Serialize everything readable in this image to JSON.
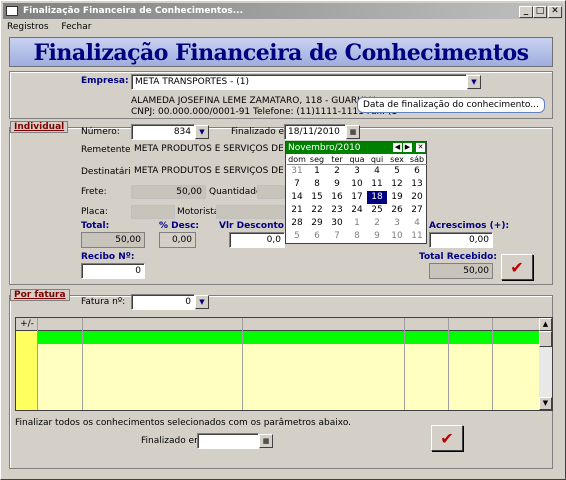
{
  "window": {
    "title": "Finalização Financeira de Conhecimentos..."
  },
  "menu": {
    "items": [
      "Registros",
      "Fechar"
    ]
  },
  "header": {
    "title": "Finalização Financeira de Conhecimentos"
  },
  "empresa": {
    "label": "Empresa:",
    "value": "META TRANSPORTES - (1)",
    "address": "ALAMEDA JOSEFINA LEME ZAMATARO, 118 - GUARULH",
    "cnpj": "CNPJ: 00.000.000/0001-91 Telefone: (11)1111-1111 Fax: (1"
  },
  "individual": {
    "section_label": "Individual",
    "numero_label": "Número:",
    "numero_value": "834",
    "finalizado_label": "Finalizado em:",
    "finalizado_value": "18/11/2010",
    "remetente_label": "Remetente:",
    "remetente_value": "META PRODUTOS E SERVIÇOS DE IN",
    "destinatario_label": "Destinatário:",
    "destinatario_value": "META PRODUTOS E SERVIÇOS DE IN",
    "frete_label": "Frete:",
    "frete_value": "50,00",
    "quantidade_label": "Quantidade:",
    "placa_label": "Placa:",
    "motorista_label": "Motorista:",
    "total_label": "Total:",
    "total_value": "50,00",
    "desc_label": "% Desc:",
    "desc_value": "0,00",
    "vlr_desconto_label": "Vlr Desconto (",
    "vlr_desconto_value": "0,0",
    "acrescimos_label": "Acrescimos (+):",
    "acrescimos_value": "0,00",
    "recibo_label": "Recibo Nº:",
    "recibo_value": "0",
    "total_recebido_label": "Total Recebido:",
    "total_recebido_value": "50,00"
  },
  "tooltip": {
    "text": "Data de finalização do conhecimento..."
  },
  "calendar": {
    "month": "Novembro/2010",
    "dow": [
      "dom",
      "seg",
      "ter",
      "qua",
      "qui",
      "sex",
      "sáb"
    ],
    "weeks": [
      [
        "31",
        "1",
        "2",
        "3",
        "4",
        "5",
        "6"
      ],
      [
        "7",
        "8",
        "9",
        "10",
        "11",
        "12",
        "13"
      ],
      [
        "14",
        "15",
        "16",
        "17",
        "18",
        "19",
        "20"
      ],
      [
        "21",
        "22",
        "23",
        "24",
        "25",
        "26",
        "27"
      ],
      [
        "28",
        "29",
        "30",
        "1",
        "2",
        "3",
        "4"
      ],
      [
        "5",
        "6",
        "7",
        "8",
        "9",
        "10",
        "11"
      ]
    ],
    "selected": "18"
  },
  "por_fatura": {
    "section_label": "Por fatura",
    "fatura_label": "Fatura nº:",
    "fatura_value": "0",
    "grid_header_button": "+/-",
    "footer_note": "Finalizar todos os conhecimentos selecionados com os parâmetros abaixo.",
    "finalizado_label": "Finalizado em:",
    "finalizado_value": ""
  },
  "colors": {
    "accent": "#000080",
    "selected_row": "#00ff00",
    "grid_row": "#ffffc0",
    "section_label": "#800000",
    "calendar_header": "#008000"
  }
}
